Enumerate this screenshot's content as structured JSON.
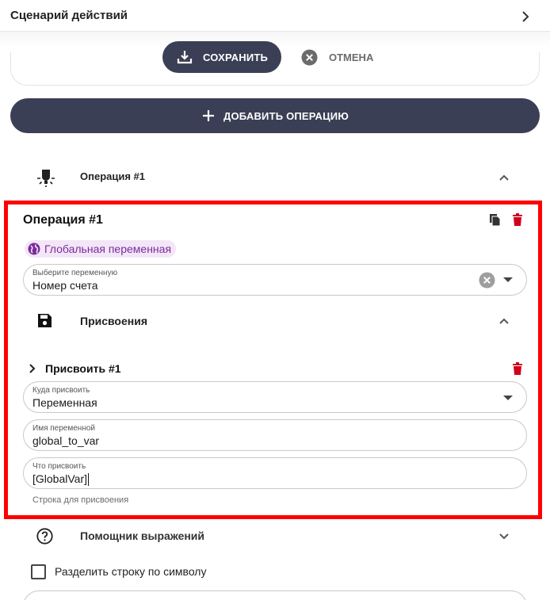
{
  "header": {
    "title": "Сценарий действий"
  },
  "toolbar": {
    "save_label": "СОХРАНИТЬ",
    "cancel_label": "ОТМЕНА"
  },
  "add_operation": {
    "label": "ДОБАВИТЬ ОПЕРАЦИЮ"
  },
  "operation_section": {
    "title": "Операция #1"
  },
  "operation_card": {
    "title": "Операция #1",
    "scope_chip": "Глобальная переменная",
    "variable_field": {
      "label": "Выберите переменную",
      "value": "Номер счета"
    },
    "assignments_section": {
      "title": "Присвоения"
    },
    "assignment": {
      "title": "Присвоить #1",
      "target_field": {
        "label": "Куда присвоить",
        "value": "Переменная"
      },
      "name_field": {
        "label": "Имя переменной",
        "value": "global_to_var"
      },
      "value_field": {
        "label": "Что присвоить",
        "value": "[GlobalVar]"
      },
      "hint": "Строка для присвоения"
    }
  },
  "expression_helper": {
    "title": "Помощник выражений"
  },
  "split_option": {
    "label": "Разделить строку по символу",
    "checked": false
  },
  "colors": {
    "primary_button": "#3b3f55",
    "highlight": "#ff0000",
    "delete": "#d0021b",
    "chip_bg": "#f3e6f7",
    "chip_text": "#7b2b9c"
  }
}
